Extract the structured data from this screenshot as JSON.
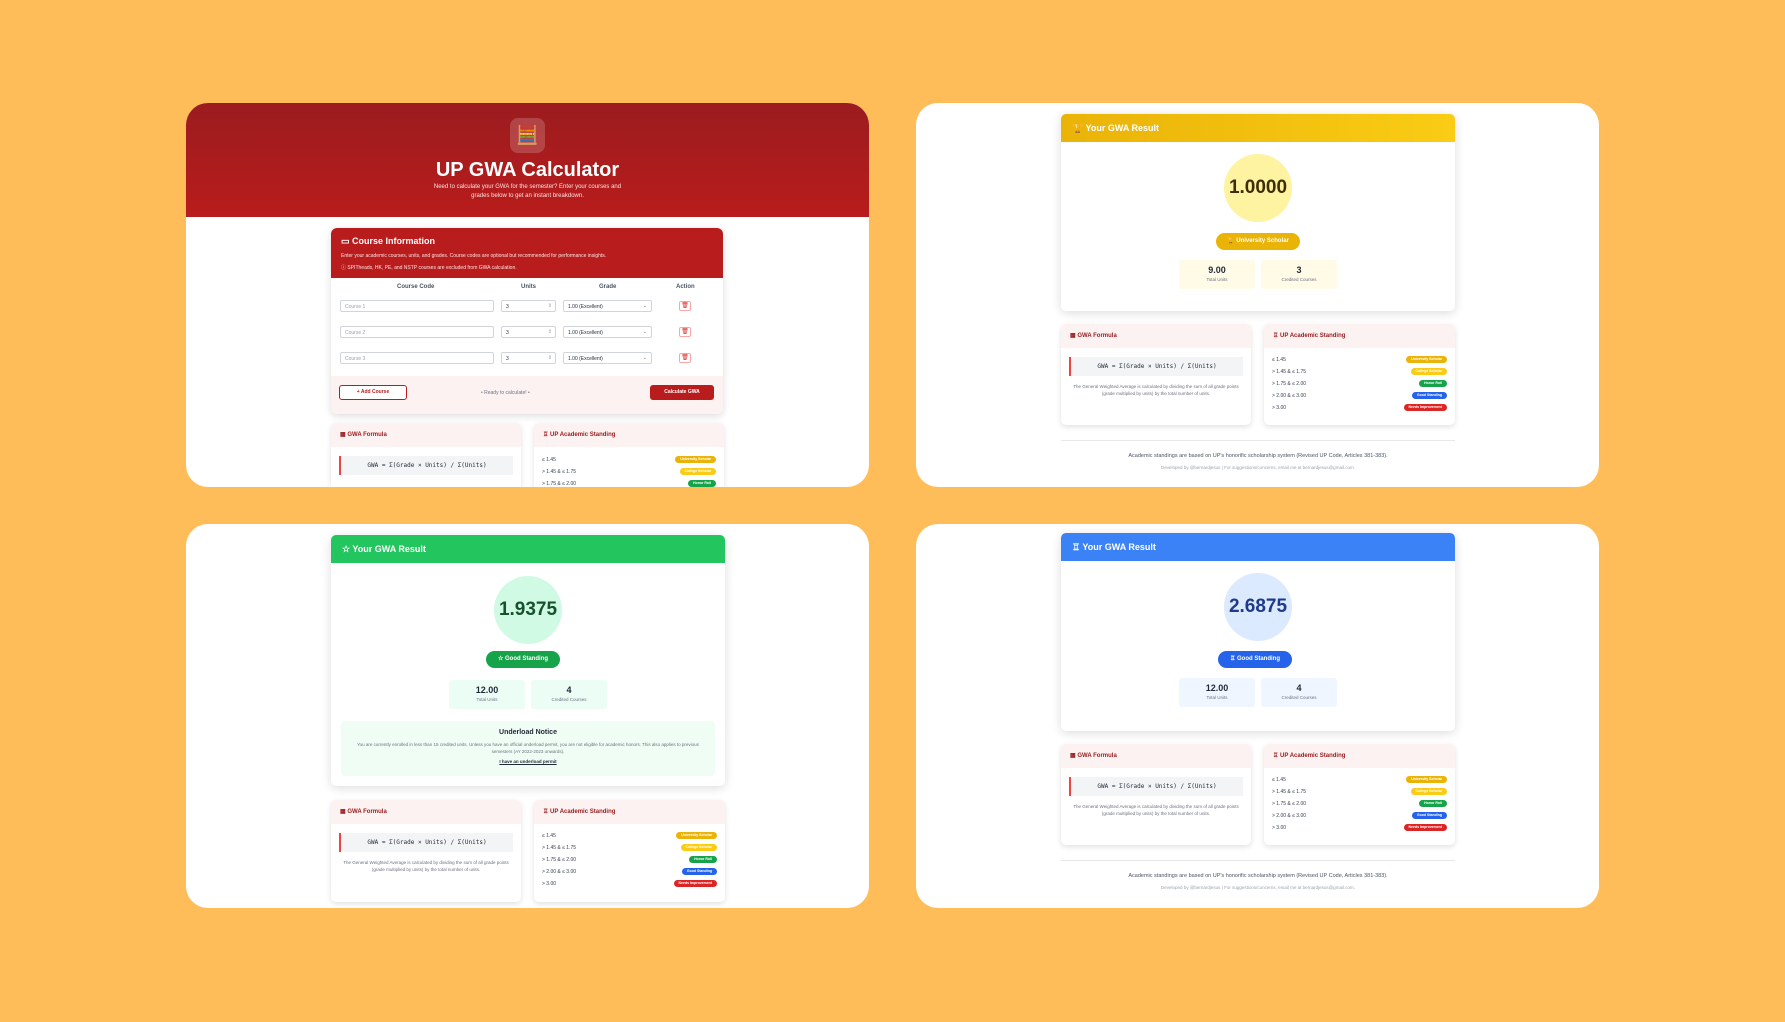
{
  "calculator": {
    "title": "UP GWA Calculator",
    "subtitle": "Need to calculate your GWA for the semester? Enter your courses and grades below to get an instant breakdown.",
    "course_info": {
      "title": "Course Information",
      "desc": "Enter your academic courses, units, and grades. Course codes are optional but recommended for performance insights.",
      "note": "SPITheads, HK, PE, and NSTP courses are excluded from GWA calculation.",
      "headers": [
        "Course Code",
        "Units",
        "Grade",
        "Action"
      ],
      "rows": [
        {
          "placeholder": "Course 1",
          "units": "3",
          "grade": "1.00 (Excellent)"
        },
        {
          "placeholder": "Course 2",
          "units": "3",
          "grade": "1.00 (Excellent)"
        },
        {
          "placeholder": "Course 3",
          "units": "3",
          "grade": "1.00 (Excellent)"
        }
      ],
      "add_label": "Add Course",
      "ready_text": "• Ready to calculate! •",
      "calc_label": "Calculate GWA"
    }
  },
  "formula_card": {
    "title": "GWA Formula",
    "formula": "GWA = Σ(Grade × Units) / Σ(Units)",
    "desc": "The General Weighted Average is calculated by dividing the sum of all grade points (grade multiplied by units) by the total number of units."
  },
  "standing_card": {
    "title": "UP Academic Standing",
    "rows": [
      {
        "range": "≤ 1.45",
        "badge": "University Scholar"
      },
      {
        "range": "> 1.45 & ≤ 1.75",
        "badge": "College Scholar"
      },
      {
        "range": "> 1.75 & ≤ 2.00",
        "badge": "Honor Roll"
      },
      {
        "range": "> 2.00 & ≤ 3.00",
        "badge": "Good Standing"
      },
      {
        "range": "> 3.00",
        "badge": "Needs Improvement"
      }
    ]
  },
  "results": [
    {
      "header": "Your GWA Result",
      "gwa": "1.0000",
      "standing": "University Scholar",
      "total_units": "9.00",
      "credited": "3",
      "color": "#eab308"
    },
    {
      "header": "Your GWA Result",
      "gwa": "1.9375",
      "standing": "Good Standing",
      "total_units": "12.00",
      "credited": "4",
      "color": "#22c55e"
    },
    {
      "header": "Your GWA Result",
      "gwa": "2.6875",
      "standing": "Good Standing",
      "total_units": "12.00",
      "credited": "4",
      "color": "#3b82f6"
    }
  ],
  "stat_labels": {
    "units": "Total Units",
    "courses": "Credited Courses"
  },
  "underload": {
    "title": "Underload Notice",
    "desc": "You are currently enrolled in less than 15 credited units. Unless you have an official underload permit, you are not eligible for academic honors. This also applies to previous semesters (AY 2022-2023 onwards).",
    "link": "I have an underload permit"
  },
  "footer": {
    "line1": "Academic standings are based on UP's honorific scholarship system (Revised UP Code, Articles 381-383).",
    "line2": "Developed by @bernardjesus | For suggestions/concerns, email me at bernardjesus@gmail.com."
  }
}
